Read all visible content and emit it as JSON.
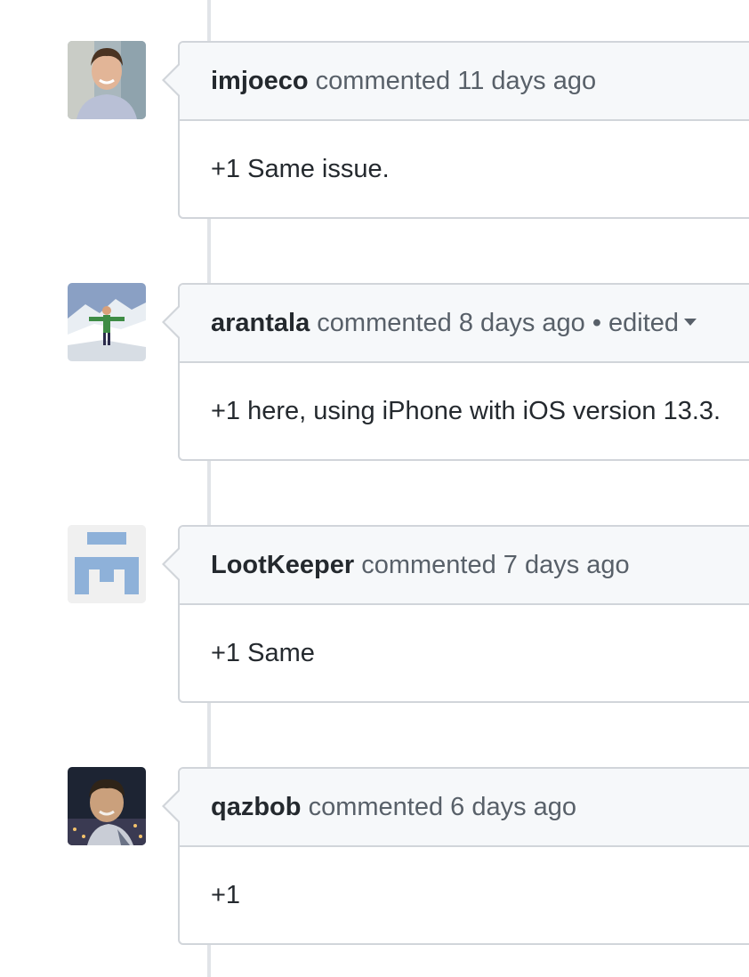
{
  "comments": [
    {
      "author": "imjoeco",
      "action": "commented",
      "time": "11 days ago",
      "body": "+1 Same issue.",
      "avatar": "photo-avatar"
    },
    {
      "author": "arantala",
      "action": "commented",
      "time": "8 days ago",
      "edited_separator": "•",
      "edited_label": "edited",
      "body": "+1 here, using iPhone with iOS version 13.3.",
      "avatar": "photo-avatar"
    },
    {
      "author": "LootKeeper",
      "action": "commented",
      "time": "7 days ago",
      "body": "+1 Same",
      "avatar": "identicon-avatar"
    },
    {
      "author": "qazbob",
      "action": "commented",
      "time": "6 days ago",
      "body": "+1",
      "avatar": "photo-avatar"
    }
  ],
  "colors": {
    "timeline": "#e1e4e8",
    "border": "#d1d5da",
    "header_bg": "#f6f8fa",
    "muted_text": "#586069",
    "text": "#24292e",
    "identicon": "#8eb1d9"
  }
}
